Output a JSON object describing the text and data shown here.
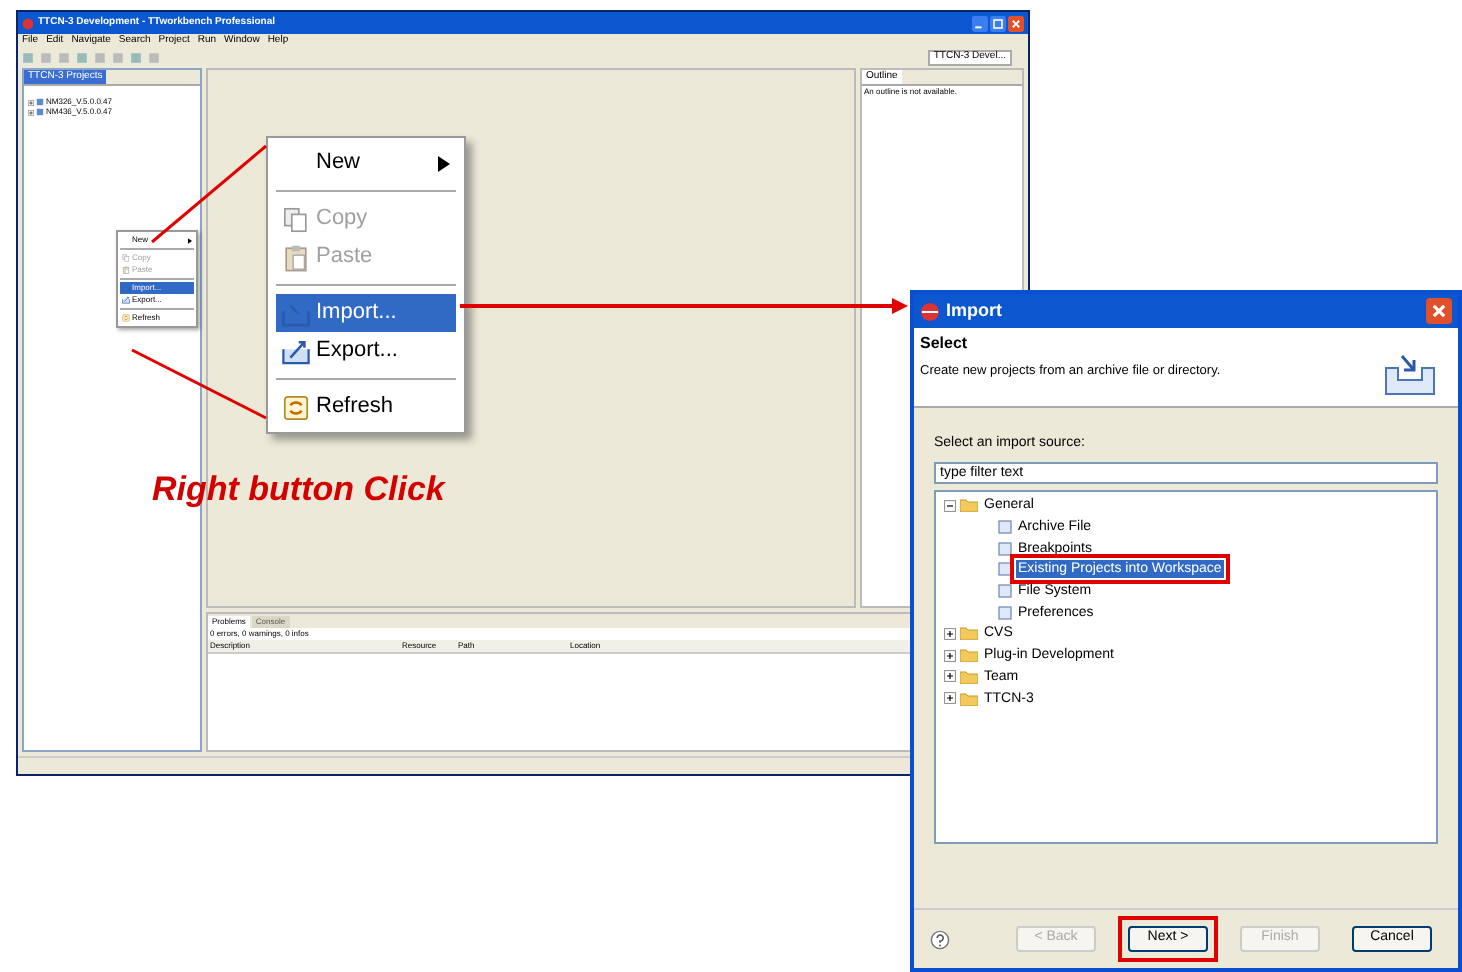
{
  "ide_window": {
    "title": "TTCN-3 Development - TTworkbench Professional",
    "menu": [
      "File",
      "Edit",
      "Navigate",
      "Search",
      "Project",
      "Run",
      "Window",
      "Help"
    ],
    "perspective": "TTCN-3 Devel...",
    "projects_view": {
      "tab": "TTCN-3 Projects",
      "tree": [
        {
          "label": "NM326_V.5.0.0.47"
        },
        {
          "label": "NM436_V.5.0.0.47"
        }
      ]
    },
    "context_menu": [
      {
        "kind": "item",
        "label": "New",
        "submenu": true,
        "disabled": false,
        "selected": false
      },
      {
        "kind": "separator"
      },
      {
        "kind": "item",
        "label": "Copy",
        "submenu": false,
        "disabled": true,
        "selected": false
      },
      {
        "kind": "item",
        "label": "Paste",
        "submenu": false,
        "disabled": true,
        "selected": false
      },
      {
        "kind": "separator"
      },
      {
        "kind": "item",
        "label": "Import...",
        "submenu": false,
        "disabled": false,
        "selected": true
      },
      {
        "kind": "item",
        "label": "Export...",
        "submenu": false,
        "disabled": false,
        "selected": false
      },
      {
        "kind": "separator"
      },
      {
        "kind": "item",
        "label": "Refresh",
        "submenu": false,
        "disabled": false,
        "selected": false
      }
    ],
    "outline_view": {
      "tab": "Outline",
      "message": "An outline is not available."
    },
    "problems_view": {
      "tabs": [
        {
          "label": "Problems",
          "selected": true
        },
        {
          "label": "Console",
          "selected": false
        }
      ],
      "summary": "0 errors, 0 warnings, 0 infos",
      "columns": [
        "Description",
        "Resource",
        "Path",
        "Location"
      ]
    }
  },
  "callout_menu": [
    {
      "kind": "item",
      "label": "New",
      "submenu": true,
      "disabled": false,
      "selected": false
    },
    {
      "kind": "separator"
    },
    {
      "kind": "item",
      "label": "Copy",
      "submenu": false,
      "disabled": true,
      "selected": false
    },
    {
      "kind": "item",
      "label": "Paste",
      "submenu": false,
      "disabled": true,
      "selected": false
    },
    {
      "kind": "separator"
    },
    {
      "kind": "item",
      "label": "Import...",
      "submenu": false,
      "disabled": false,
      "selected": true
    },
    {
      "kind": "item",
      "label": "Export...",
      "submenu": false,
      "disabled": false,
      "selected": false
    },
    {
      "kind": "separator"
    },
    {
      "kind": "item",
      "label": "Refresh",
      "submenu": false,
      "disabled": false,
      "selected": false
    }
  ],
  "caption": "Right button Click",
  "import_dialog": {
    "title": "Import",
    "heading": "Select",
    "description": "Create new projects from an archive file or directory.",
    "source_label": "Select an import source:",
    "filter": {
      "value": "type filter text"
    },
    "tree": [
      {
        "label": "General",
        "expanded": true,
        "selected": false,
        "marked": false,
        "children": [
          {
            "label": "Archive File",
            "selected": false,
            "marked": false
          },
          {
            "label": "Breakpoints",
            "selected": false,
            "marked": false
          },
          {
            "label": "Existing Projects into Workspace",
            "selected": true,
            "marked": true
          },
          {
            "label": "File System",
            "selected": false,
            "marked": false
          },
          {
            "label": "Preferences",
            "selected": false,
            "marked": false
          }
        ]
      },
      {
        "label": "CVS",
        "expanded": false,
        "selected": false,
        "marked": false
      },
      {
        "label": "Plug-in Development",
        "expanded": false,
        "selected": false,
        "marked": false
      },
      {
        "label": "Team",
        "expanded": false,
        "selected": false,
        "marked": false
      },
      {
        "label": "TTCN-3",
        "expanded": false,
        "selected": false,
        "marked": false
      }
    ],
    "buttons": [
      {
        "label": "< Back",
        "disabled": true,
        "marked": false
      },
      {
        "label": "Next >",
        "disabled": false,
        "marked": true
      },
      {
        "label": "Finish",
        "disabled": true,
        "marked": false
      },
      {
        "label": "Cancel",
        "disabled": false,
        "marked": false
      }
    ]
  }
}
